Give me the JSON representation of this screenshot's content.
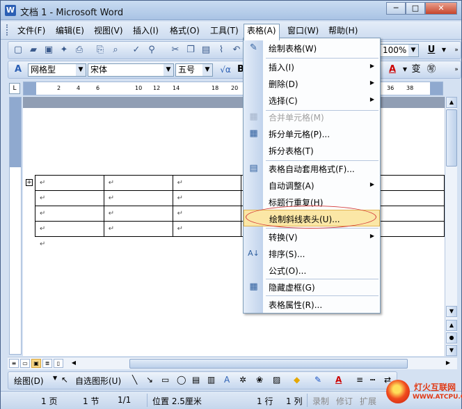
{
  "window": {
    "title": "文档 1 - Microsoft Word",
    "app_icon": "W",
    "min_glyph": "─",
    "max_glyph": "□",
    "close_glyph": "✕"
  },
  "menubar": {
    "items": [
      "文件(F)",
      "编辑(E)",
      "视图(V)",
      "插入(I)",
      "格式(O)",
      "工具(T)",
      "表格(A)",
      "窗口(W)",
      "帮助(H)"
    ]
  },
  "toolbar1": {
    "zoom": "100%",
    "underline": "U"
  },
  "toolbar2": {
    "style": "网格型",
    "font": "宋体",
    "size": "五号",
    "bold": "B"
  },
  "ruler": {
    "ticks": [
      "2",
      "4",
      "6",
      "10",
      "12",
      "14",
      "18",
      "20",
      "36",
      "38"
    ]
  },
  "document": {
    "cell_mark": "↵",
    "rows": 4
  },
  "table_menu": {
    "items": [
      {
        "label": "绘制表格(W)",
        "icon": "pencil-icon",
        "glyph": "✎",
        "submenu": false,
        "enabled": true
      },
      {
        "label": "插入(I)",
        "icon": "",
        "glyph": "",
        "submenu": true,
        "enabled": true
      },
      {
        "label": "删除(D)",
        "icon": "",
        "glyph": "",
        "submenu": true,
        "enabled": true
      },
      {
        "label": "选择(C)",
        "icon": "",
        "glyph": "",
        "submenu": true,
        "enabled": true
      },
      {
        "label": "合并单元格(M)",
        "icon": "merge-cells-icon",
        "glyph": "▦",
        "submenu": false,
        "enabled": false
      },
      {
        "label": "拆分单元格(P)...",
        "icon": "split-cells-icon",
        "glyph": "▦",
        "submenu": false,
        "enabled": true
      },
      {
        "label": "拆分表格(T)",
        "icon": "",
        "glyph": "",
        "submenu": false,
        "enabled": true
      },
      {
        "label": "表格自动套用格式(F)...",
        "icon": "autoformat-icon",
        "glyph": "▤",
        "submenu": false,
        "enabled": true
      },
      {
        "label": "自动调整(A)",
        "icon": "",
        "glyph": "",
        "submenu": true,
        "enabled": true
      },
      {
        "label": "标题行重复(H)",
        "icon": "",
        "glyph": "",
        "submenu": false,
        "enabled": true
      },
      {
        "label": "绘制斜线表头(U)...",
        "icon": "",
        "glyph": "",
        "submenu": false,
        "enabled": true,
        "highlighted": true
      },
      {
        "label": "转换(V)",
        "icon": "",
        "glyph": "",
        "submenu": true,
        "enabled": true
      },
      {
        "label": "排序(S)...",
        "icon": "sort-icon",
        "glyph": "A↓",
        "submenu": false,
        "enabled": true
      },
      {
        "label": "公式(O)...",
        "icon": "",
        "glyph": "",
        "submenu": false,
        "enabled": true
      },
      {
        "label": "隐藏虚框(G)",
        "icon": "gridlines-icon",
        "glyph": "▦",
        "submenu": false,
        "enabled": true
      },
      {
        "label": "表格属性(R)...",
        "icon": "",
        "glyph": "",
        "submenu": false,
        "enabled": true
      }
    ]
  },
  "drawbar": {
    "draw_label": "绘图(D)",
    "autoshapes_label": "自选图形(U)"
  },
  "statusbar": {
    "page": "1 页",
    "section": "1 节",
    "pages": "1/1",
    "position": "位置 2.5厘米",
    "line": "1 行",
    "column": "1 列",
    "rec": "录制",
    "trk": "修订",
    "ext": "扩展"
  },
  "watermark": {
    "name": "灯火互联网",
    "url": "WWW.ATCPU.COM"
  }
}
